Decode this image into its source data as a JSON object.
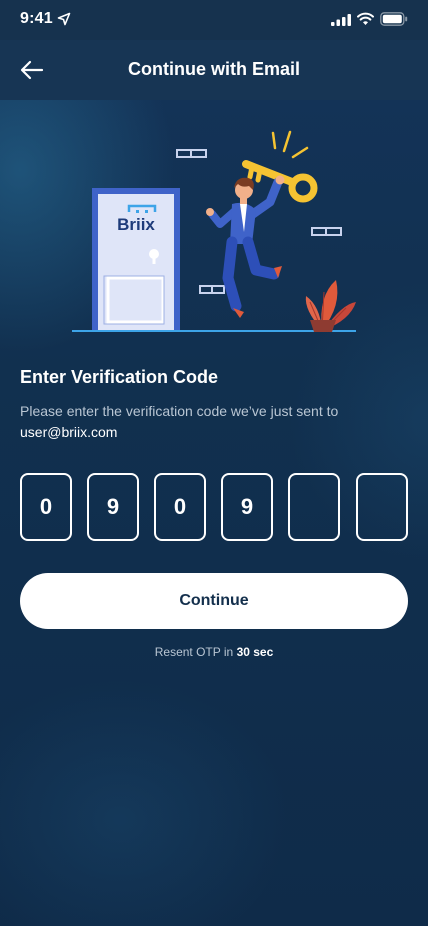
{
  "status_bar": {
    "time": "9:41"
  },
  "header": {
    "title": "Continue with Email"
  },
  "illustration": {
    "door_brand": "Briix"
  },
  "verification": {
    "title": "Enter Verification Code",
    "description": "Please enter the verification code we’ve just sent to",
    "email": "user@briix.com"
  },
  "otp": {
    "digits": [
      "0",
      "9",
      "0",
      "9",
      "",
      ""
    ]
  },
  "actions": {
    "continue_label": "Continue"
  },
  "resend": {
    "prefix": "Resent OTP in",
    "countdown": "30 sec"
  },
  "colors": {
    "background": "#11304f",
    "button_bg": "#ffffff",
    "button_text": "#132f4c",
    "muted_text": "#b9c6d3",
    "accent_yellow": "#f5c332",
    "accent_blue": "#3f63c9"
  }
}
